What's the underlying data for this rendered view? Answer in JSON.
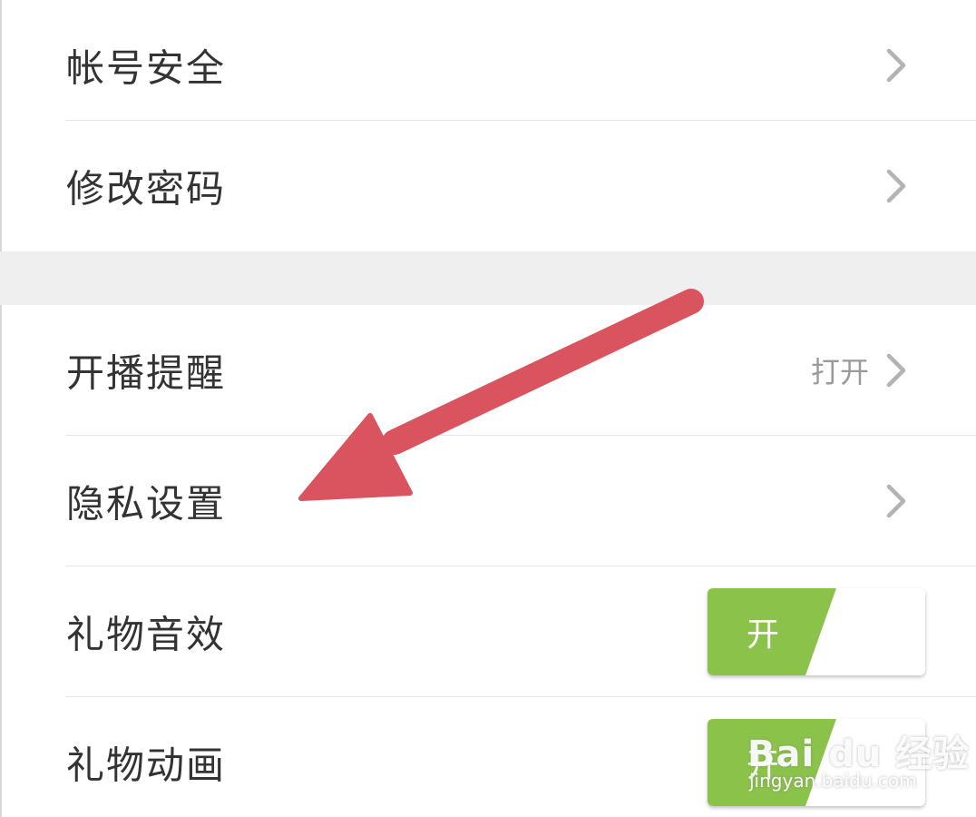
{
  "settings": {
    "account_security": {
      "label": "帐号安全"
    },
    "change_password": {
      "label": "修改密码"
    },
    "live_reminder": {
      "label": "开播提醒",
      "value": "打开"
    },
    "privacy_settings": {
      "label": "隐私设置"
    },
    "gift_sound": {
      "label": "礼物音效",
      "toggle_label": "开",
      "on": true
    },
    "gift_animation": {
      "label": "礼物动画",
      "toggle_label": "开",
      "on": true
    }
  },
  "colors": {
    "toggle_on": "#8bc34a",
    "arrow": "#d9545e",
    "text": "#333333",
    "secondary_text": "#9a9a9a",
    "section_gap": "#efefef",
    "divider": "#e6e6e6"
  },
  "watermark": {
    "brand": "Bai du 经验",
    "url": "jingyan.baidu.com"
  }
}
